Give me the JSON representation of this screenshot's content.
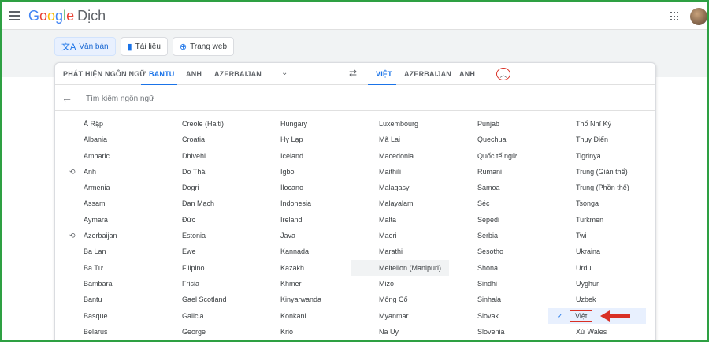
{
  "app": {
    "logo_letters": [
      "G",
      "o",
      "o",
      "g",
      "l",
      "e"
    ],
    "logo_suffix": "Dịch"
  },
  "modes": [
    {
      "label": "Văn bản",
      "icon": "translate-icon"
    },
    {
      "label": "Tài liệu",
      "icon": "document-icon"
    },
    {
      "label": "Trang web",
      "icon": "globe-icon"
    }
  ],
  "source_tabs": [
    "PHÁT HIỆN NGÔN NGỮ",
    "BANTU",
    "ANH",
    "AZERBAIJAN"
  ],
  "target_tabs": [
    "VIỆT",
    "AZERBAIJAN",
    "ANH"
  ],
  "search": {
    "placeholder": "Tìm kiếm ngôn ngữ"
  },
  "columns": [
    [
      "Á Rập",
      "Albania",
      "Amharic",
      "Anh",
      "Armenia",
      "Assam",
      "Aymara",
      "Azerbaijan",
      "Ba Lan",
      "Ba Tư",
      "Bambara",
      "Bantu",
      "Basque",
      "Belarus"
    ],
    [
      "Creole (Haiti)",
      "Croatia",
      "Dhivehi",
      "Do Thái",
      "Dogri",
      "Đan Mạch",
      "Đức",
      "Estonia",
      "Ewe",
      "Filipino",
      "Frisia",
      "Gael Scotland",
      "Galicia",
      "George"
    ],
    [
      "Hungary",
      "Hy Lạp",
      "Iceland",
      "Igbo",
      "Ilocano",
      "Indonesia",
      "Ireland",
      "Java",
      "Kannada",
      "Kazakh",
      "Khmer",
      "Kinyarwanda",
      "Konkani",
      "Krio"
    ],
    [
      "Luxembourg",
      "Mã Lai",
      "Macedonia",
      "Maithili",
      "Malagasy",
      "Malayalam",
      "Malta",
      "Maori",
      "Marathi",
      "Meiteilon (Manipuri)",
      "Mizo",
      "Mông Cổ",
      "Myanmar",
      "Na Uy"
    ],
    [
      "Punjab",
      "Quechua",
      "Quốc tế ngữ",
      "Rumani",
      "Samoa",
      "Séc",
      "Sepedi",
      "Serbia",
      "Sesotho",
      "Shona",
      "Sindhi",
      "Sinhala",
      "Slovak",
      "Slovenia"
    ],
    [
      "Thổ Nhĩ Kỳ",
      "Thụy Điển",
      "Tigrinya",
      "Trung (Giản thể)",
      "Trung (Phồn thể)",
      "Tsonga",
      "Turkmen",
      "Twi",
      "Ukraina",
      "Urdu",
      "Uyghur",
      "Uzbek",
      "Việt",
      "Xứ Wales"
    ]
  ],
  "recent_languages": [
    "Anh",
    "Azerbaijan"
  ],
  "highlighted_item": "Meiteilon (Manipuri)",
  "selected_target": "Việt",
  "colors": {
    "accent": "#1a73e8",
    "annotation": "#d93025",
    "frame": "#2ea043"
  }
}
